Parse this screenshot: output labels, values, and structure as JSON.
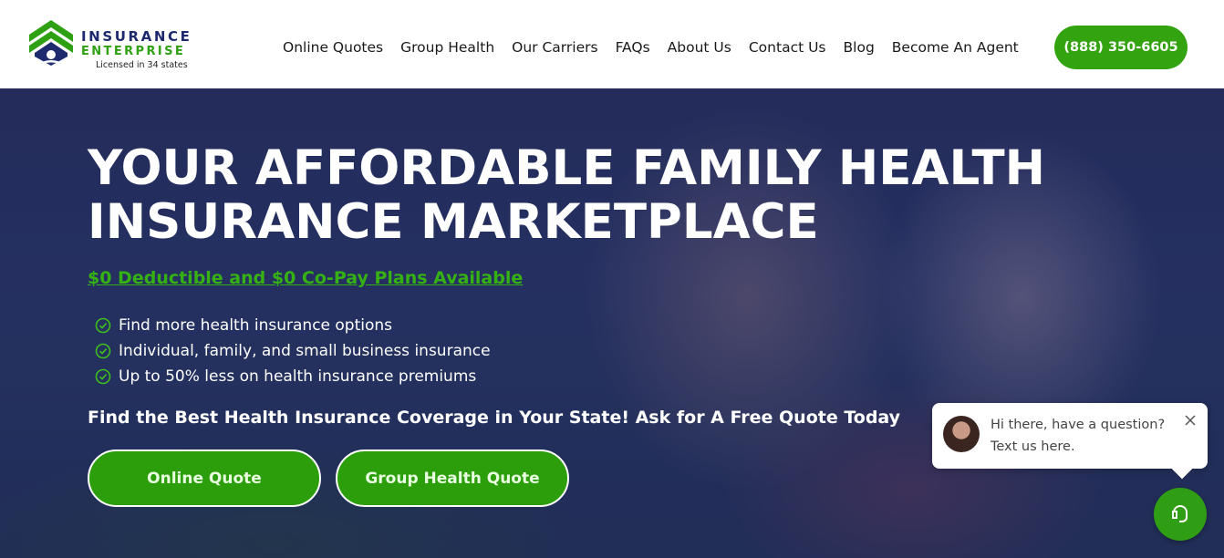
{
  "logo": {
    "line1": "INSURANCE",
    "line2": "ENTERPRISE",
    "line3": "Licensed in 34 states",
    "icon": "house-chevron-logo"
  },
  "nav": {
    "items": [
      "Online Quotes",
      "Group Health",
      "Our Carriers",
      "FAQs",
      "About Us",
      "Contact Us",
      "Blog",
      "Become An Agent"
    ],
    "phone": "(888) 350-6605"
  },
  "hero": {
    "title": "YOUR AFFORDABLE FAMILY HEALTH INSURANCE MARKETPLACE",
    "subtitle": "$0 Deductible and $0 Co-Pay Plans Available",
    "bullets": [
      "Find more health insurance options",
      "Individual, family, and small business insurance",
      "Up to 50% less on health insurance premiums"
    ],
    "cta_text": "Find the Best Health Insurance Coverage in Your State! Ask for A Free Quote Today",
    "buttons": {
      "online": "Online Quote",
      "group": "Group Health Quote"
    }
  },
  "chat": {
    "line1": "Hi there, have a question?",
    "line2": "Text us here.",
    "icons": [
      "close-icon",
      "chat-icon"
    ]
  },
  "colors": {
    "brand_green": "#33a30f",
    "brand_navy": "#1d2a6e",
    "white": "#ffffff"
  }
}
